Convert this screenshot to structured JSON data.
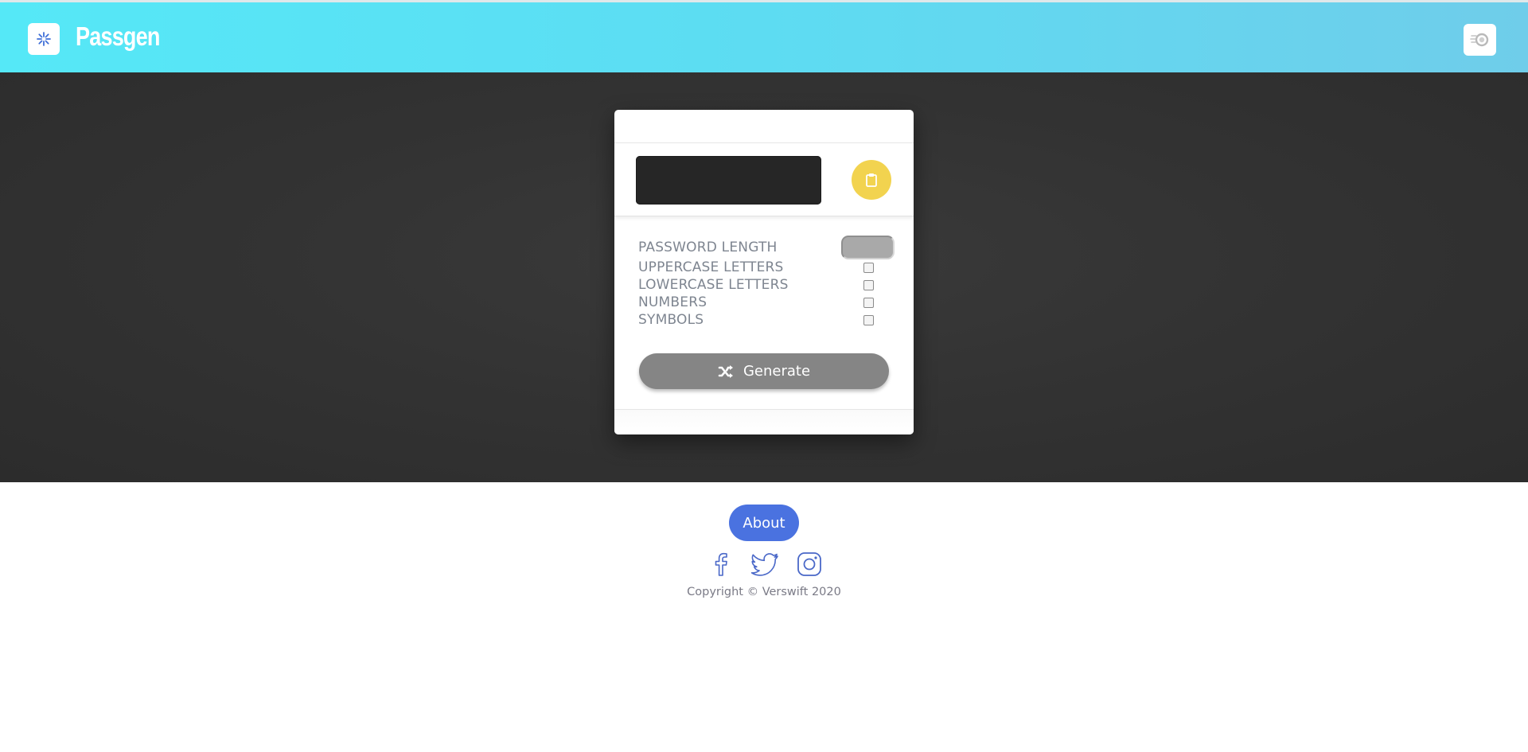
{
  "header": {
    "app_title": "Passgen",
    "logo_icon": "snowflake-icon",
    "theme_toggle_icon": "theme-toggle-icon"
  },
  "generator": {
    "copy_icon": "clipboard-icon",
    "settings": [
      {
        "label": "PASSWORD LENGTH",
        "control": "number"
      },
      {
        "label": "UPPERCASE LETTERS",
        "control": "checkbox"
      },
      {
        "label": "LOWERCASE LETTERS",
        "control": "checkbox"
      },
      {
        "label": "NUMBERS",
        "control": "checkbox"
      },
      {
        "label": "SYMBOLS",
        "control": "checkbox"
      }
    ],
    "generate_label": "Generate",
    "generate_icon": "shuffle-icon"
  },
  "footer": {
    "about_label": "About",
    "social_icons": [
      "facebook-icon",
      "twitter-icon",
      "instagram-icon"
    ],
    "copyright": "Copyright © Verswift 2020"
  },
  "colors": {
    "header_gradient_start": "#55e8f7",
    "header_gradient_end": "#6fcdea",
    "background_dark": "#333333",
    "copy_button": "#f2d34f",
    "generate_button": "#858585",
    "about_button": "#4a72e0",
    "social_icon": "#4a68c8"
  }
}
